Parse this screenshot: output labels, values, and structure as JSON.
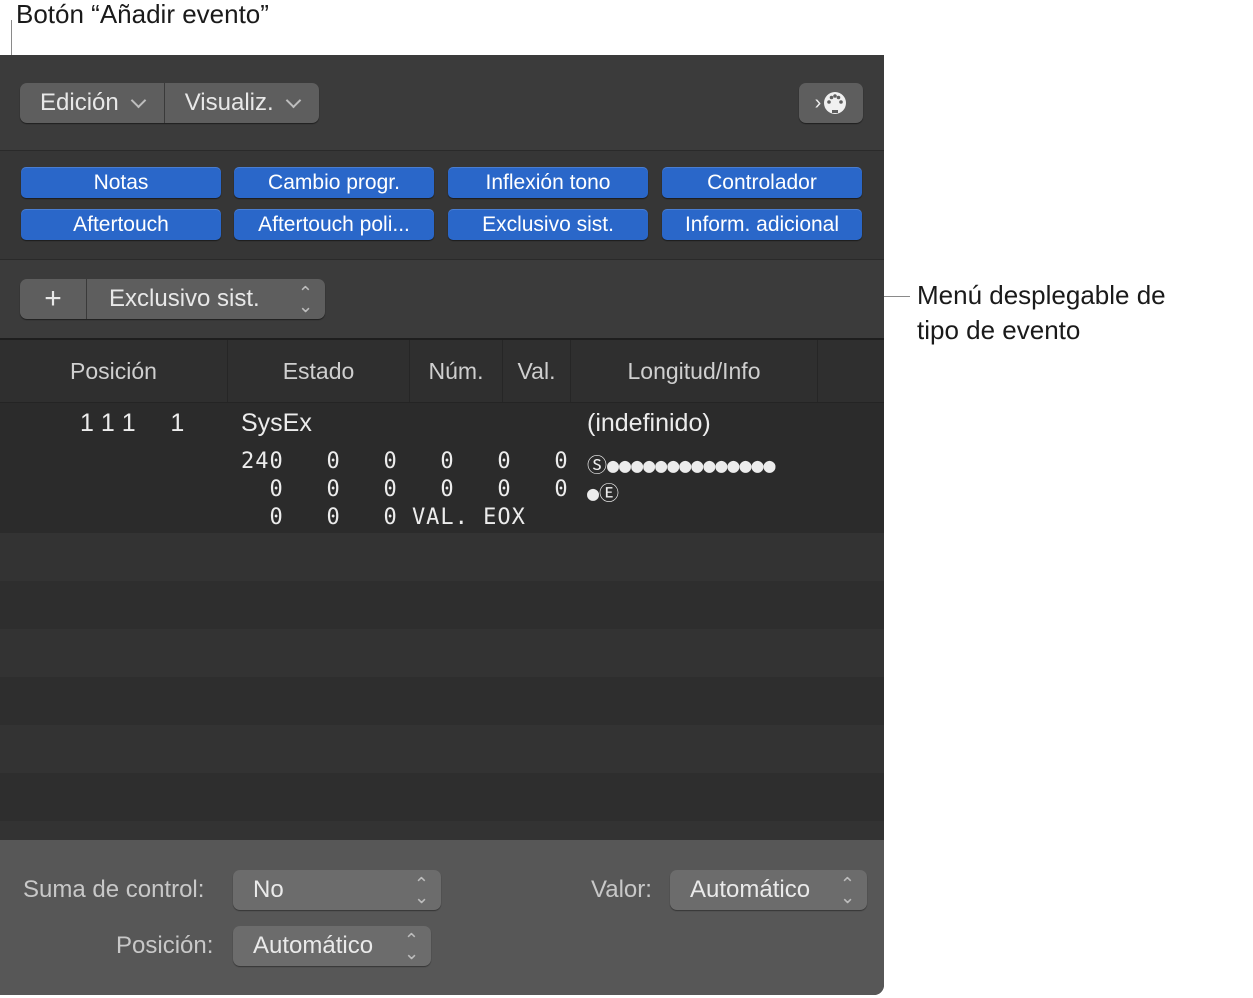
{
  "callouts": {
    "add_button": "Botón “Añadir evento”",
    "type_menu_line1": "Menú desplegable de",
    "type_menu_line2": "tipo de evento"
  },
  "toolbar": {
    "edit_menu": "Edición",
    "view_menu": "Visualiz.",
    "midi_icon": "midi-connector-icon"
  },
  "filters": [
    "Notas",
    "Cambio progr.",
    "Inflexión tono",
    "Controlador",
    "Aftertouch",
    "Aftertouch poli...",
    "Exclusivo sist.",
    "Inform. adicional"
  ],
  "add_bar": {
    "add_symbol": "+",
    "event_type": "Exclusivo sist."
  },
  "table": {
    "headers": [
      "Posición",
      "Estado",
      "Núm.",
      "Val.",
      "Longitud/Info"
    ],
    "row": {
      "position": "1 1 1     1",
      "status": "SysEx",
      "info": "(indefinido)",
      "data_line1": "240   0   0   0   0   0",
      "data_line2": "  0   0   0   0   0   0",
      "data_line3": "  0   0   0 VAL. EOX",
      "dots_line1": "Ⓢ●●●●●●●●●●●●●●",
      "dots_line2": "●Ⓔ"
    }
  },
  "bottom": {
    "checksum_label": "Suma de control:",
    "checksum_value": "No",
    "value_label": "Valor:",
    "value_value": "Automático",
    "position_label": "Posición:",
    "position_value": "Automático"
  }
}
